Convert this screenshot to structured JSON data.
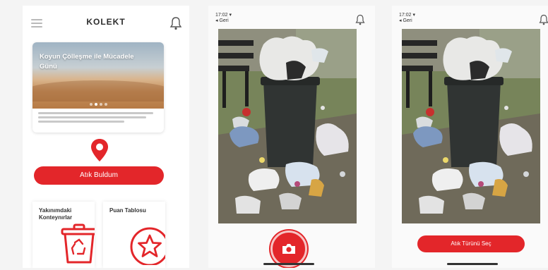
{
  "home": {
    "logo": "KOLEKT",
    "news": {
      "title": "Koyun Çölleşme ile Mücadele Günü"
    },
    "primary_button": "Atık Buldum",
    "tiles": [
      {
        "label": "Yakınımdaki Konteynırlar",
        "icon": "recycle-bin-icon"
      },
      {
        "label": "Puan Tablosu",
        "icon": "star-icon"
      }
    ]
  },
  "capture": {
    "status": {
      "time": "17:02",
      "back": "Geri"
    },
    "action": "camera-icon"
  },
  "choose": {
    "status": {
      "time": "17:02",
      "back": "Geri"
    },
    "button": "Atık Türünü Seç"
  },
  "colors": {
    "accent": "#e3262a"
  }
}
